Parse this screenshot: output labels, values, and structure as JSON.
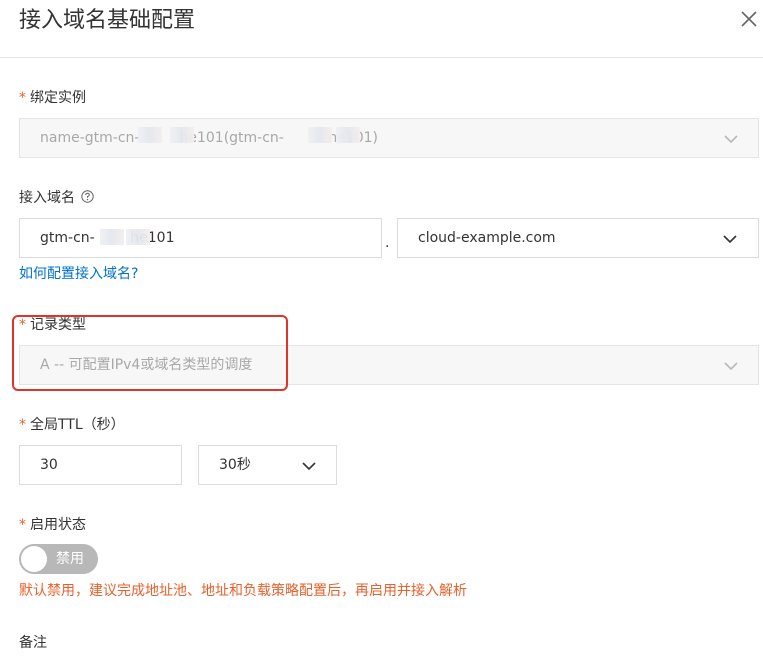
{
  "dialog": {
    "title": "接入域名基础配置"
  },
  "fields": {
    "instance": {
      "required": "*",
      "label": "绑定实例",
      "value": "name-gtm-cn-         he101(gtm-cn-          ne101)"
    },
    "domain": {
      "label": "接入域名",
      "prefix_value": "gtm-cn-        he101",
      "separator": ".",
      "suffix_value": "cloud-example.com",
      "help_link": "如何配置接入域名?"
    },
    "record_type": {
      "required": "*",
      "label": "记录类型",
      "value": "A -- 可配置IPv4或域名类型的调度"
    },
    "ttl": {
      "required": "*",
      "label": "全局TTL（秒）",
      "value": "30",
      "unit_select": "30秒"
    },
    "status": {
      "required": "*",
      "label": "启用状态",
      "toggle_text": "禁用",
      "enabled": false,
      "warning": "默认禁用，建议完成地址池、地址和负载策略配置后，再启用并接入解析"
    },
    "remark": {
      "label": "备注"
    }
  },
  "colors": {
    "required": "#e8612c",
    "link": "#0070cc",
    "highlight": "#e0342a",
    "toggle_off": "#b8b8b8"
  },
  "icons": [
    "close-icon",
    "chevron-down-icon",
    "help-circle-icon"
  ]
}
